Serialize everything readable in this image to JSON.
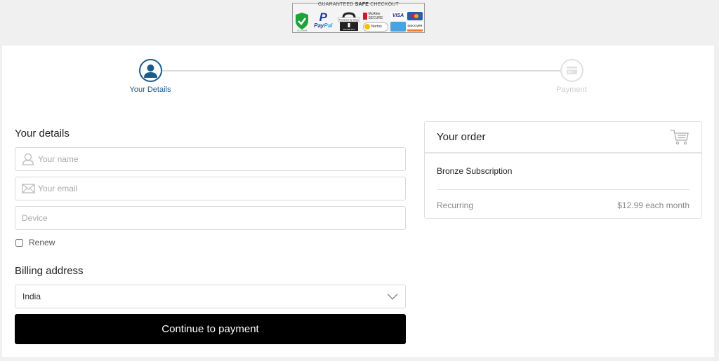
{
  "trust_badge": {
    "title_prefix": "GUARANTEED",
    "title_bold": "SAFE",
    "title_suffix": "CHECKOUT",
    "ssl_label": "SSL ENAB",
    "paypal_part1": "Pay",
    "paypal_part2": "Pal",
    "stripe_label": "Powered by stripe",
    "stripe_sub": "SECURE SITE",
    "mcafee_label": "McAfee SECURE",
    "norton_label": "Norton",
    "visa_label": "VISA",
    "discover_label": "DISCOVER"
  },
  "steps": [
    {
      "label": "Your Details",
      "icon": "user-icon",
      "active": true
    },
    {
      "label": "Payment",
      "icon": "credit-card-icon",
      "active": false
    }
  ],
  "details": {
    "title": "Your details",
    "name_placeholder": "Your name",
    "email_placeholder": "Your email",
    "device_placeholder": "Device",
    "renew_label": "Renew",
    "renew_checked": false
  },
  "billing": {
    "title": "Billing address",
    "country_selected": "India"
  },
  "cta": {
    "label": "Continue to payment"
  },
  "order": {
    "title": "Your order",
    "item": "Bronze Subscription",
    "recurring_label": "Recurring",
    "recurring_value": "$12.99 each month"
  },
  "colors": {
    "accent": "#1d5a86",
    "inactive": "#cfcfcf",
    "button_bg": "#000000",
    "page_bg": "#f0f0f0"
  }
}
